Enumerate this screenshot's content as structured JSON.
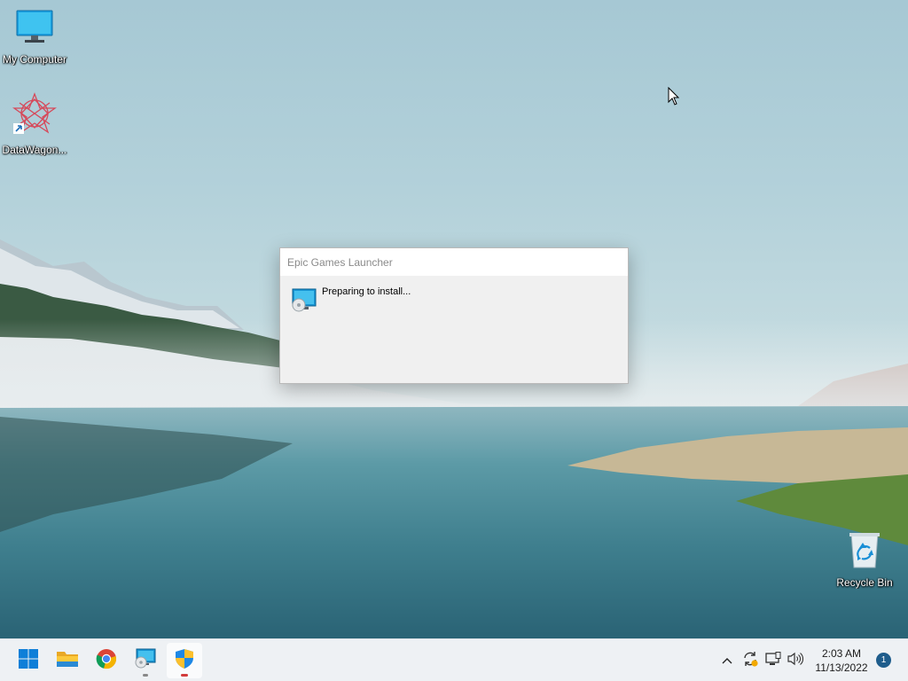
{
  "desktop": {
    "icons": [
      {
        "label": "My Computer",
        "icon": "monitor-icon"
      },
      {
        "label": "DataWagon...",
        "icon": "datawagon-shortcut-icon"
      },
      {
        "label": "Recycle Bin",
        "icon": "recycle-bin-icon"
      }
    ]
  },
  "dialog": {
    "title": "Epic Games Launcher",
    "message": "Preparing to install...",
    "icon": "installer-monitor-icon"
  },
  "taskbar": {
    "apps": [
      {
        "name": "Start",
        "icon": "windows-start-icon"
      },
      {
        "name": "File Explorer",
        "icon": "folder-icon"
      },
      {
        "name": "Google Chrome",
        "icon": "chrome-icon"
      },
      {
        "name": "Installer",
        "icon": "installer-icon"
      },
      {
        "name": "User Account Control",
        "icon": "security-shield-icon"
      }
    ],
    "tray": {
      "time": "2:03 AM",
      "date": "11/13/2022",
      "notification_count": "1"
    }
  },
  "colors": {
    "accent": "#0067c0",
    "notification_badge": "#1f5d8c"
  }
}
